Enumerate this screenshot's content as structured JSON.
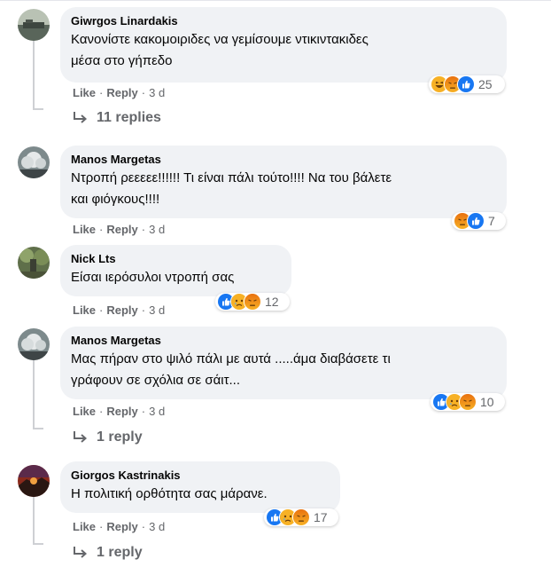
{
  "comments": [
    {
      "author": "Giwrgos Linardakis",
      "text_lines": [
        "Κανονίστε κακομοιριδες να γεμίσουμε ντικιντακιδες",
        "μέσα στο γήπεδο"
      ],
      "reaction_icons": [
        "haha-icon",
        "angry-icon",
        "like-icon"
      ],
      "reaction_count": "25",
      "actions": {
        "like": "Like",
        "reply": "Reply",
        "time": "3 d"
      },
      "replies_label": "11 replies"
    },
    {
      "author": "Manos Margetas",
      "text_lines": [
        "Ντροπή ρεεεεε!!!!!! Τι είναι πάλι τούτο!!!! Να του βάλετε",
        "και φιόγκους!!!!"
      ],
      "reaction_icons": [
        "angry-icon",
        "like-icon"
      ],
      "reaction_count": "7",
      "actions": {
        "like": "Like",
        "reply": "Reply",
        "time": "3 d"
      }
    },
    {
      "author": "Nick Lts",
      "text_lines": [
        "Είσαι ιερόσυλοι ντροπή σας"
      ],
      "reaction_icons": [
        "like-icon",
        "sad-icon",
        "angry-icon"
      ],
      "reaction_count": "12",
      "actions": {
        "like": "Like",
        "reply": "Reply",
        "time": "3 d"
      }
    },
    {
      "author": "Manos Margetas",
      "text_lines": [
        "Μας πήραν στο ψιλό πάλι με αυτά .....άμα διαβάσετε τι",
        "γράφουν σε σχόλια σε σάιτ..."
      ],
      "reaction_icons": [
        "like-icon",
        "sad-icon",
        "angry-icon"
      ],
      "reaction_count": "10",
      "actions": {
        "like": "Like",
        "reply": "Reply",
        "time": "3 d"
      },
      "replies_label": "1 reply"
    },
    {
      "author": "Giorgos Kastrinakis",
      "text_lines": [
        "Η πολιτική ορθότητα σας μάρανε."
      ],
      "reaction_icons": [
        "like-icon",
        "sad-icon",
        "angry-icon"
      ],
      "reaction_count": "17",
      "actions": {
        "like": "Like",
        "reply": "Reply",
        "time": "3 d"
      },
      "replies_label": "1 reply"
    }
  ],
  "colors": {
    "bubble": "#f0f2f5",
    "meta_text": "#65676b",
    "thread_line": "#ced0d4",
    "like_blue": "#1877f2",
    "angry_orange": "#e9710f",
    "yellow": "#f7b125"
  }
}
